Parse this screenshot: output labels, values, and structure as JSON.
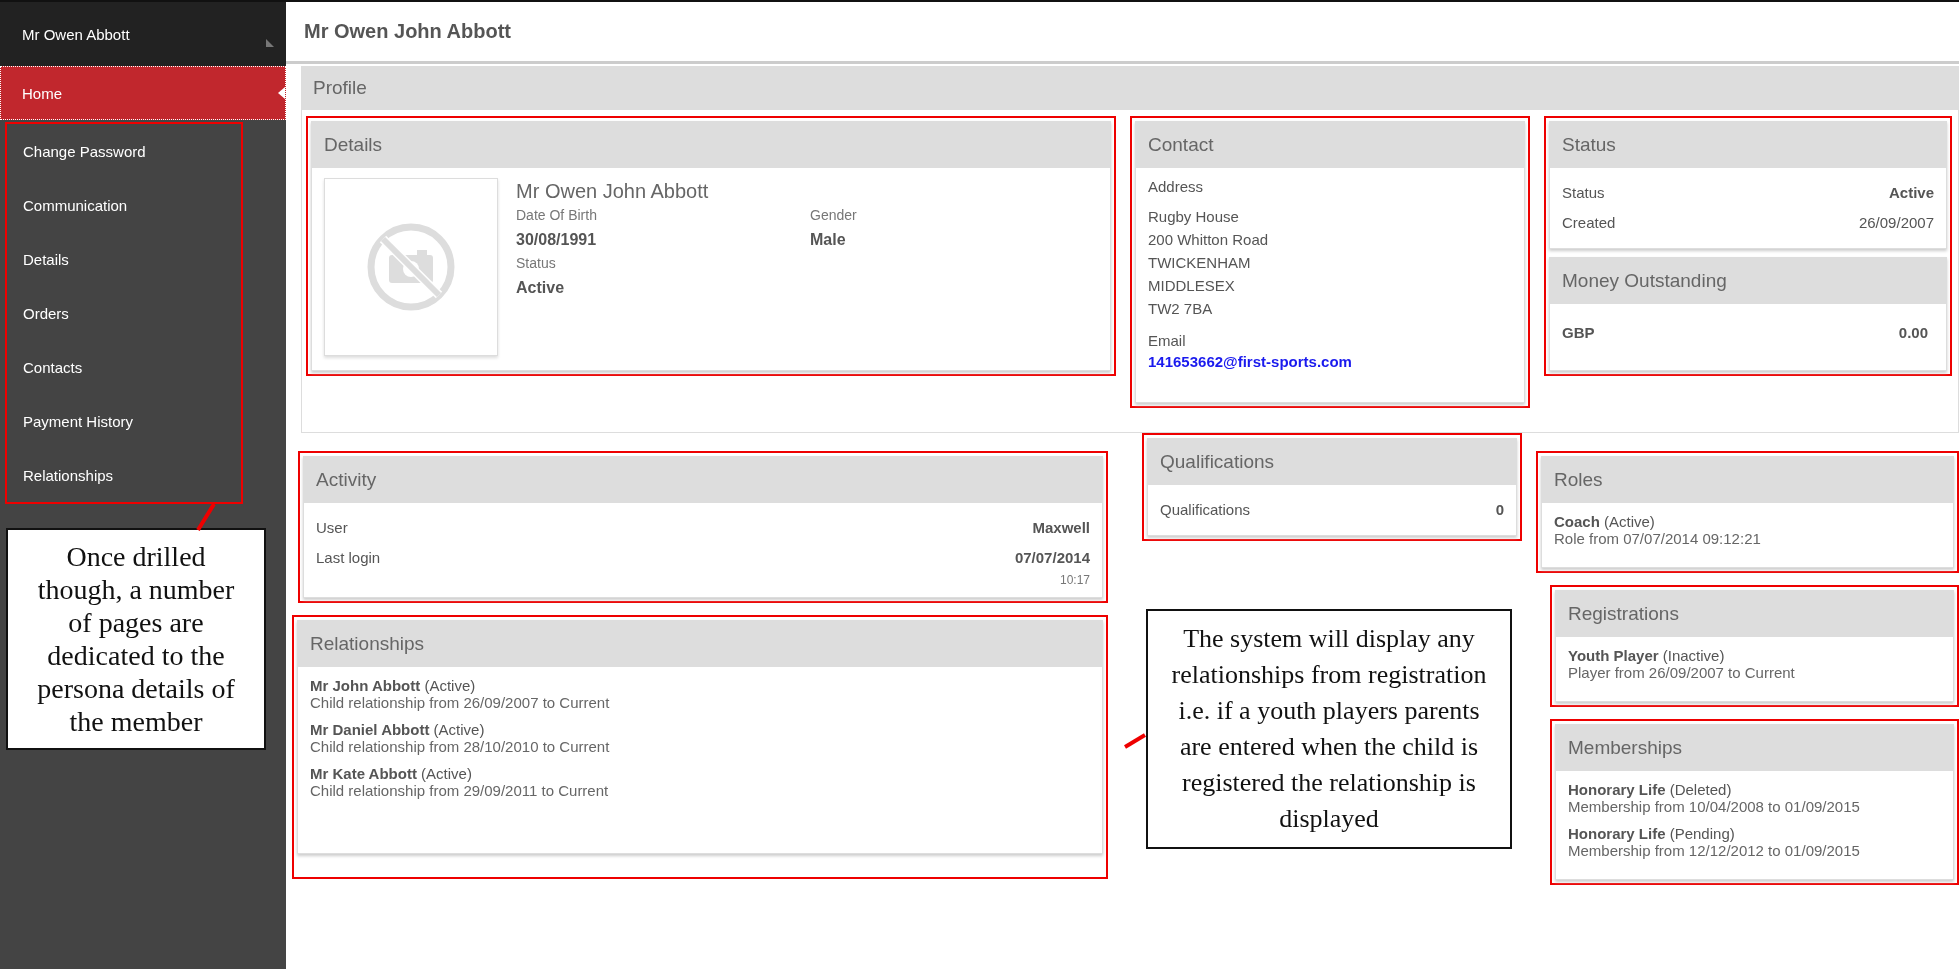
{
  "sidebar": {
    "user": "Mr Owen Abbott",
    "items": [
      {
        "label": "Home",
        "selected": true
      },
      {
        "label": "Change Password",
        "selected": false
      },
      {
        "label": "Communication",
        "selected": false
      },
      {
        "label": "Details",
        "selected": false
      },
      {
        "label": "Orders",
        "selected": false
      },
      {
        "label": "Contacts",
        "selected": false
      },
      {
        "label": "Payment History",
        "selected": false
      },
      {
        "label": "Relationships",
        "selected": false
      }
    ]
  },
  "page_title": "Mr Owen John Abbott",
  "section_title": "Profile",
  "details": {
    "title": "Details",
    "name": "Mr Owen John Abbott",
    "fields": [
      {
        "label": "Date Of Birth",
        "value": "30/08/1991"
      },
      {
        "label": "Gender",
        "value": "Male"
      },
      {
        "label": "Status",
        "value": "Active"
      }
    ]
  },
  "contact": {
    "title": "Contact",
    "address_label": "Address",
    "address_lines": [
      "Rugby House",
      "200 Whitton Road",
      "TWICKENHAM",
      "MIDDLESEX",
      "TW2 7BA"
    ],
    "email_label": "Email",
    "email": "141653662@first-sports.com"
  },
  "status": {
    "title": "Status",
    "rows": [
      {
        "label": "Status",
        "value": "Active",
        "bold": true
      },
      {
        "label": "Created",
        "value": "26/09/2007",
        "bold": false
      }
    ]
  },
  "money": {
    "title": "Money Outstanding",
    "currency": "GBP",
    "amount": "0.00"
  },
  "activity": {
    "title": "Activity",
    "user_label": "User",
    "user": "Maxwell",
    "login_label": "Last login",
    "login_date": "07/07/2014",
    "login_time": "10:17"
  },
  "qualifications": {
    "title": "Qualifications",
    "label": "Qualifications",
    "count": "0"
  },
  "relationships": {
    "title": "Relationships",
    "entries": [
      {
        "name": "Mr John Abbott",
        "state": "(Active)",
        "detail": "Child relationship from 26/09/2007 to Current"
      },
      {
        "name": "Mr Daniel Abbott",
        "state": "(Active)",
        "detail": "Child relationship from 28/10/2010 to Current"
      },
      {
        "name": "Mr Kate Abbott",
        "state": "(Active)",
        "detail": "Child relationship from 29/09/2011 to Current"
      }
    ]
  },
  "roles": {
    "title": "Roles",
    "entries": [
      {
        "name": "Coach",
        "state": "(Active)",
        "detail": "Role   from 07/07/2014 09:12:21"
      }
    ]
  },
  "registrations": {
    "title": "Registrations",
    "entries": [
      {
        "name": "Youth Player",
        "state": "(Inactive)",
        "detail": "Player from 26/09/2007 to Current"
      }
    ]
  },
  "memberships": {
    "title": "Memberships",
    "entries": [
      {
        "name": "Honorary Life",
        "state": "(Deleted)",
        "detail": "Membership from 10/04/2008 to 01/09/2015"
      },
      {
        "name": "Honorary Life",
        "state": "(Pending)",
        "detail": "Membership from 12/12/2012 to 01/09/2015"
      }
    ]
  },
  "annotations": [
    {
      "text": "Once drilled though, a number of pages are dedicated to the persona details of the member"
    },
    {
      "text": "The system will display any relationships from registration i.e. if a youth players parents are entered when the child is registered the relationship is displayed"
    }
  ]
}
